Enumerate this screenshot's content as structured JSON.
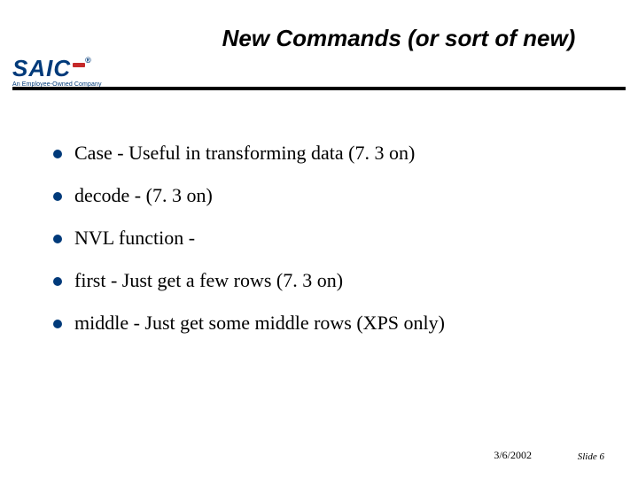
{
  "title": "New Commands (or sort of new)",
  "logo": {
    "text": "SAIC",
    "reg": "®",
    "tagline": "An Employee-Owned Company"
  },
  "items": [
    "Case - Useful in transforming data (7. 3 on)",
    "decode - (7. 3 on)",
    "NVL function -",
    "first - Just get a few rows (7. 3 on)",
    "middle - Just get some middle rows (XPS only)"
  ],
  "footer": {
    "date": "3/6/2002",
    "slide": "Slide 6"
  }
}
